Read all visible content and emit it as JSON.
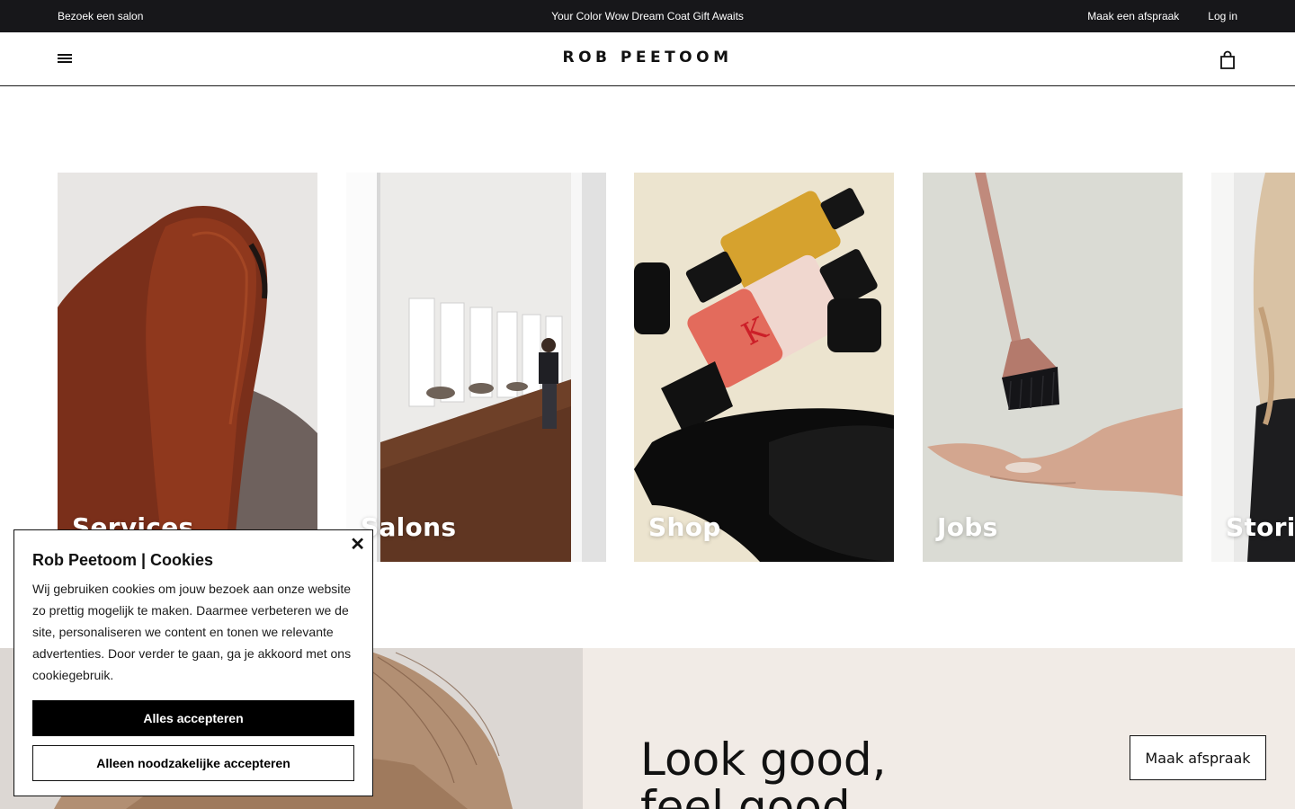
{
  "topbar": {
    "visit_salon": "Bezoek een salon",
    "promo": "Your Color Wow Dream Coat Gift Awaits",
    "make_appointment": "Maak een afspraak",
    "login": "Log in"
  },
  "header": {
    "logo": "ROB PEETOOM",
    "menu_icon": "hamburger-menu-icon",
    "bag_icon": "shopping-bag-icon"
  },
  "cards": [
    {
      "label": "Services",
      "image": "woman with long red hair from behind"
    },
    {
      "label": "Salons",
      "image": "salon interior with mirrors and stylist"
    },
    {
      "label": "Shop",
      "image": "Kérastase hair oil bottles"
    },
    {
      "label": "Jobs",
      "image": "hair dye brush above hand"
    },
    {
      "label": "Stories",
      "image": "blonde woman portrait"
    }
  ],
  "hero": {
    "title_line1": "Look good,",
    "title_line2": "feel good",
    "cta": "Maak afspraak"
  },
  "cookie": {
    "title": "Rob Peetoom | Cookies",
    "body": "Wij gebruiken cookies om jouw bezoek aan onze website zo prettig mogelijk te maken. Daarmee verbeteren we de site, personaliseren we content en tonen we relevante advertenties. Door verder te gaan, ga je akkoord met ons cookiegebruik.",
    "accept_all": "Alles accepteren",
    "accept_necessary": "Alleen noodzakelijke accepteren",
    "close_icon": "close-icon"
  },
  "colors": {
    "topbar_bg": "#17171a",
    "hero_right_bg": "#f1ebe6",
    "button_black": "#000000"
  }
}
